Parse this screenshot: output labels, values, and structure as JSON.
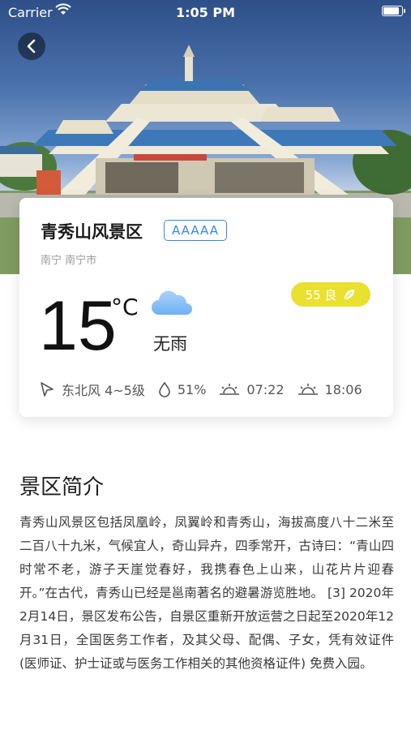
{
  "status_bar": {
    "carrier": "Carrier",
    "time": "1:05 PM"
  },
  "hero_image": {
    "description_icon": "photo"
  },
  "scenic": {
    "name": "青秀山风景区",
    "grade": "AAAAA",
    "location": "南宁 南宁市"
  },
  "weather": {
    "temperature": "15",
    "unit": "°C",
    "condition": "无雨",
    "condition_icon": "cloud-icon",
    "aqi_label": "55 良",
    "wind": "东北风 4~5级",
    "humidity": "51%",
    "sunrise": "07:22",
    "sunset": "18:06"
  },
  "intro": {
    "title": "景区简介",
    "body": "青秀山风景区包括凤凰岭，凤翼岭和青秀山，海拔高度八十二米至二百八十九米，气候宜人，奇山异卉，四季常开，古诗曰：“青山四时常不老，游子天崖觉春好，我携春色上山来，山花片片迎春开。”在古代，青秀山已经是邕南著名的避暑游览胜地。 [3]  2020年2月14日，景区发布公告，自景区重新开放运营之日起至2020年12月31日，全国医务工作者，及其父母、配偶、子女，凭有效证件 (医师证、护士证或与医务工作相关的其他资格证件) 免费入园。"
  },
  "colors": {
    "accent_blue": "#3b87e6",
    "aqi_yellow": "#e9e030"
  }
}
